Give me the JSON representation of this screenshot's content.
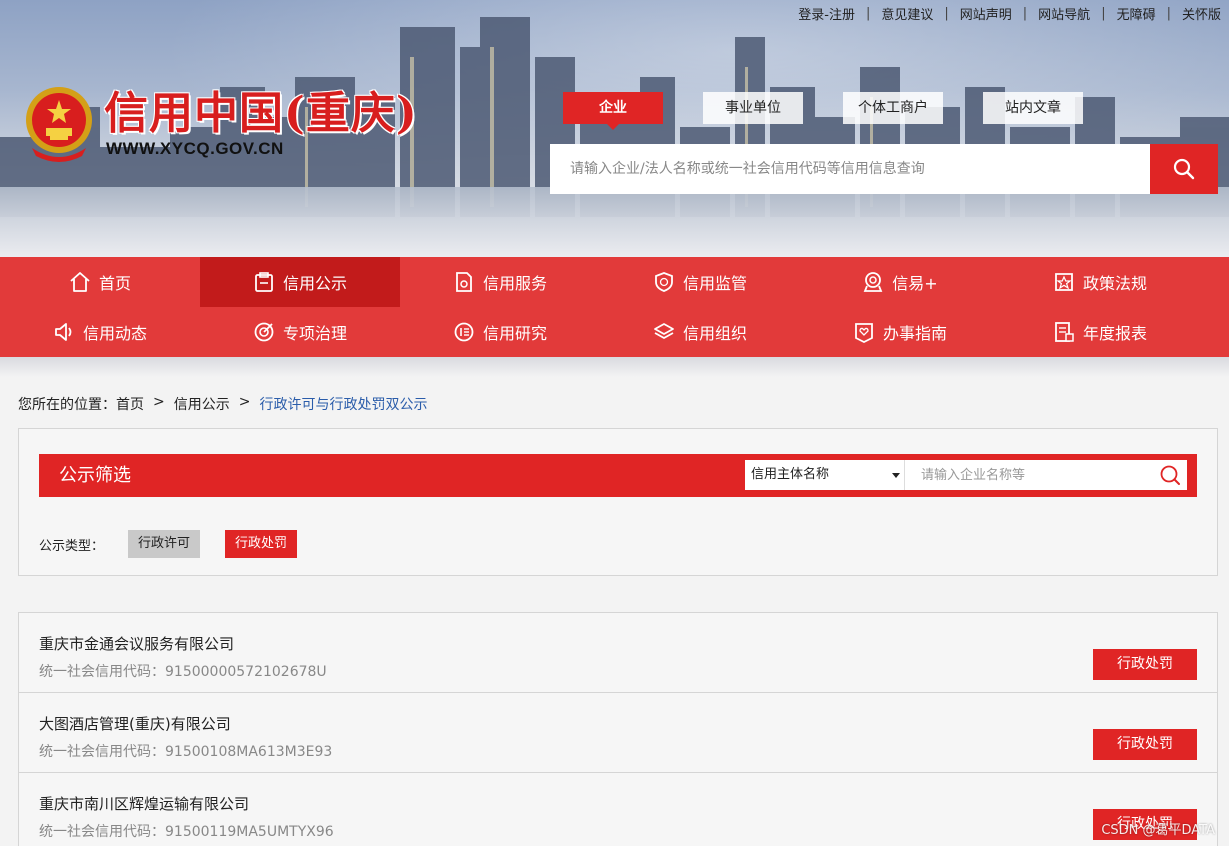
{
  "top_links": [
    "登录-注册",
    "意见建议",
    "网站声明",
    "网站导航",
    "无障碍",
    "关怀版"
  ],
  "top_link_separator": "|",
  "logo": {
    "title": "信用中国(重庆)",
    "url": "WWW.XYCQ.GOV.CN",
    "emblem_icon": "national-emblem-icon"
  },
  "search_tabs": [
    {
      "label": "企业",
      "active": true
    },
    {
      "label": "事业单位",
      "active": false
    },
    {
      "label": "个体工商户",
      "active": false
    },
    {
      "label": "站内文章",
      "active": false
    }
  ],
  "search": {
    "placeholder": "请输入企业/法人名称或统一社会信用代码等信用信息查询",
    "icon": "search-icon"
  },
  "nav": {
    "row1": [
      {
        "label": "首页",
        "icon": "home-icon",
        "active": false
      },
      {
        "label": "信用公示",
        "icon": "clipboard-icon",
        "active": true
      },
      {
        "label": "信用服务",
        "icon": "document-icon",
        "active": false
      },
      {
        "label": "信用监管",
        "icon": "shield-icon",
        "active": false
      },
      {
        "label": "信易+",
        "icon": "badge-icon",
        "active": false
      },
      {
        "label": "政策法规",
        "icon": "star-frame-icon",
        "active": false
      }
    ],
    "row2": [
      {
        "label": "信用动态",
        "icon": "speaker-icon",
        "active": false
      },
      {
        "label": "专项治理",
        "icon": "target-icon",
        "active": false
      },
      {
        "label": "信用研究",
        "icon": "seal-icon",
        "active": false
      },
      {
        "label": "信用组织",
        "icon": "layers-icon",
        "active": false
      },
      {
        "label": "办事指南",
        "icon": "heart-frame-icon",
        "active": false
      },
      {
        "label": "年度报表",
        "icon": "report-icon",
        "active": false
      }
    ]
  },
  "breadcrumb": {
    "prefix": "您所在的位置：",
    "items": [
      "首页",
      "信用公示"
    ],
    "separator": ">",
    "current": "行政许可与行政处罚双公示"
  },
  "filter": {
    "title": "公示筛选",
    "select_value": "信用主体名称",
    "input_placeholder": "请输入企业名称等",
    "type_label": "公示类型：",
    "types": [
      {
        "label": "行政许可",
        "active": false
      },
      {
        "label": "行政处罚",
        "active": true
      }
    ]
  },
  "results": [
    {
      "name": "重庆市金通会议服务有限公司",
      "code_label": "统一社会信用代码：",
      "code": "915000005721026​78U",
      "button": "行政处罚"
    },
    {
      "name": "大图酒店管理(重庆)有限公司",
      "code_label": "统一社会信用代码：",
      "code": "91500108MA613M3E93",
      "button": "行政处罚"
    },
    {
      "name": "重庆市南川区辉煌运输有限公司",
      "code_label": "统一社会信用代码：",
      "code": "91500119MA5UMTYX96",
      "button": "行政处罚"
    }
  ],
  "watermark": "CSDN @葛平DATA",
  "colors": {
    "primary_red": "#e02525",
    "nav_red": "#e23a3a",
    "nav_active": "#c21b1b",
    "link_blue": "#2a5caa"
  }
}
